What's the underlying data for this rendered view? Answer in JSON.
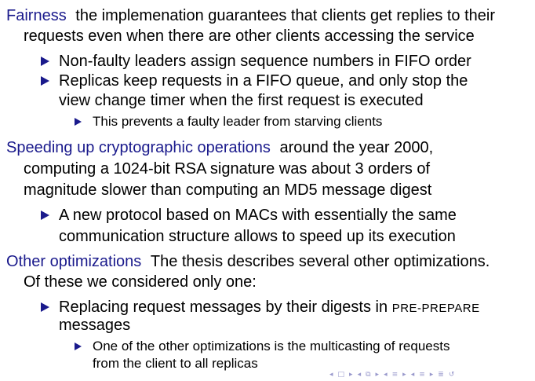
{
  "sections": [
    {
      "term": "Fairness",
      "text_line1": "the implemenation guarantees that clients get replies to their",
      "text_line2": "requests even when there are other clients accessing the service",
      "bullets": [
        {
          "line1": "Non-faulty leaders assign sequence numbers in FIFO order"
        },
        {
          "line1": "Replicas keep requests in a FIFO queue, and only stop the",
          "line2": "view change timer when the first request is executed"
        }
      ],
      "subbullets": [
        {
          "line1": "This prevents a faulty leader from starving clients"
        }
      ]
    },
    {
      "term": "Speeding up cryptographic operations",
      "text_line1": "around the year 2000,",
      "text_line2": "computing a 1024-bit RSA signature was about 3 orders of",
      "text_line3": "magnitude slower than computing an MD5 message digest",
      "bullets": [
        {
          "line1": "A new protocol based on MACs with essentially the same",
          "line2": "communication structure allows to speed up its execution"
        }
      ]
    },
    {
      "term": "Other optimizations",
      "text_line1": "The thesis describes several other optimizations.",
      "text_line2": "Of these we considered only one:",
      "bullets": [
        {
          "line1_a": "Replacing request messages by their digests in",
          "line1_sc": "PRE-PREPARE",
          "line2": "messages"
        }
      ],
      "subbullets": [
        {
          "line1": "One of the other optimizations is the multicasting of requests",
          "line2": "from the client to all replicas"
        }
      ]
    }
  ],
  "nav_icons": [
    "nav-prev-frame-icon",
    "nav-next-frame-icon",
    "nav-prev-subsection-icon",
    "nav-next-subsection-icon",
    "nav-prev-section-icon",
    "nav-next-section-icon",
    "nav-align-icon",
    "nav-search-icon"
  ]
}
